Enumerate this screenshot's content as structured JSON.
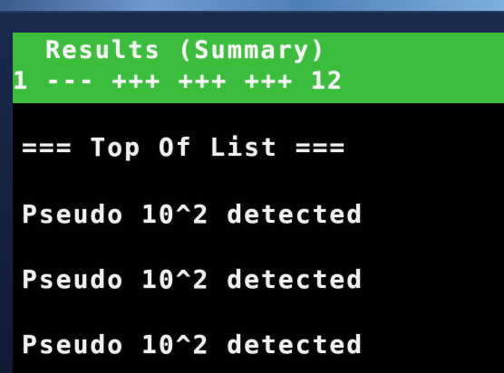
{
  "screen": {
    "header": {
      "title": "Results (Summary)",
      "status_line": "1 --- +++ +++ +++ 12"
    },
    "list": {
      "marker": "=== Top Of List ===",
      "items": [
        "Pseudo 10^2 detected",
        "Pseudo 10^2 detected",
        "Pseudo 10^2 detected"
      ]
    }
  },
  "colors": {
    "header_background": "#3bbd3c",
    "screen_background": "#010101",
    "text": "#f2f2f2"
  }
}
